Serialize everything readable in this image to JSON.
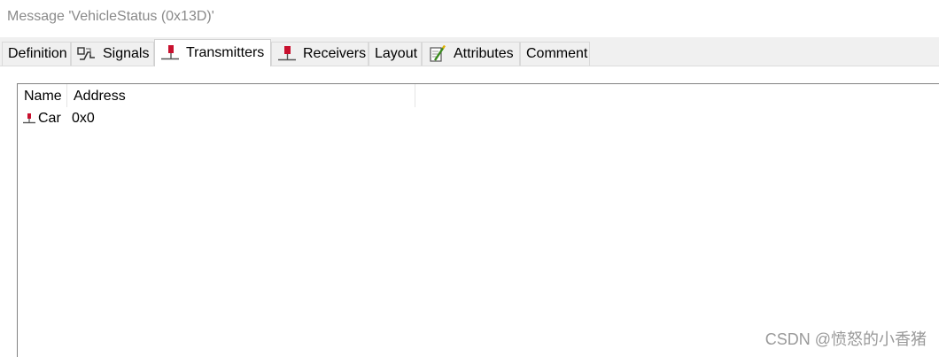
{
  "window": {
    "title": "Message 'VehicleStatus (0x13D)'"
  },
  "tabs": [
    {
      "label": "Definition",
      "icon": "",
      "active": false
    },
    {
      "label": "Signals",
      "icon": "signals-icon",
      "active": false
    },
    {
      "label": "Transmitters",
      "icon": "transmitter-node-icon",
      "active": true
    },
    {
      "label": "Receivers",
      "icon": "receiver-node-icon",
      "active": false
    },
    {
      "label": "Layout",
      "icon": "",
      "active": false
    },
    {
      "label": "Attributes",
      "icon": "attributes-icon",
      "active": false
    },
    {
      "label": "Comment",
      "icon": "",
      "active": false
    }
  ],
  "list": {
    "columns": [
      "Name",
      "Address"
    ],
    "rows": [
      {
        "icon": "network-node-icon",
        "name": "Car",
        "address": "0x0"
      }
    ]
  },
  "watermark": "CSDN @愤怒的小香猪",
  "colors": {
    "node_red": "#c8102e",
    "title_gray": "#8a8a8a",
    "tab_bg": "#f0f0f0"
  }
}
